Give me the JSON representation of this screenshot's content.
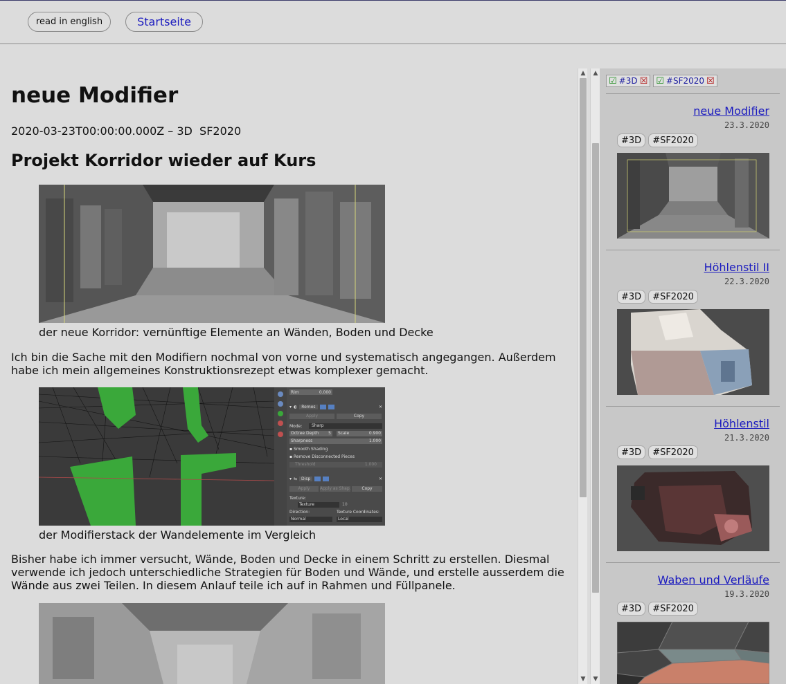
{
  "header": {
    "lang_button": "read in english",
    "home_link": "Startseite"
  },
  "article": {
    "title": "neue Modifier",
    "meta": "2020-03-23T00:00:00.000Z – 3D  SF2020",
    "subtitle": "Projekt Korridor wieder auf Kurs",
    "caption1": "der neue Korridor: vernünftige Elemente an Wänden, Boden und Decke",
    "paragraph1": "Ich bin die Sache mit den Modifiern nochmal von vorne und systematisch angegangen. Außerdem habe ich mein allgemeines Konstruktionsrezept etwas komplexer gemacht.",
    "caption2": "der Modifierstack der Wandelemente im Vergleich",
    "paragraph2": "Bisher habe ich immer versucht, Wände, Boden und Decke in einem Schritt zu erstellen. Diesmal verwende ich jedoch unterschiedliche Strategien für Boden und Wände, und erstelle ausserdem die Wände aus zwei Teilen. In diesem Anlauf teile ich auf in Rahmen und Füllpanele.",
    "blender_panel": {
      "field_rim": "Rim",
      "field_rim_value": "0.000",
      "mod1_name": "Remes",
      "apply": "Apply",
      "copy": "Copy",
      "mode_label": "Mode:",
      "mode_value": "Sharp",
      "octree_label": "Octree Depth",
      "octree_value": "5",
      "scale_label": "Scale",
      "scale_value": "0.900",
      "sharpness_label": "Sharpness",
      "sharpness_value": "1.000",
      "smooth_shading": "Smooth Shading",
      "remove_disconnected": "Remove Disconnected Pieces",
      "threshold_label": "Threshold",
      "threshold_value": "1.000",
      "mod2_name": "Disp",
      "apply_as_shape": "Apply as Shap...",
      "texture_label": "Texture:",
      "texture_value": "Texture",
      "texture_num": "10",
      "direction_label": "Direction:",
      "direction_value": "Normal",
      "coords_label": "Texture Coordinates:",
      "coords_value": "Local"
    }
  },
  "sidebar": {
    "filters": [
      "#3D",
      "#SF2020"
    ],
    "posts": [
      {
        "title": "neue Modifier",
        "date": "23.3.2020",
        "tags": [
          "#3D",
          "#SF2020"
        ]
      },
      {
        "title": "Höhlenstil II",
        "date": "22.3.2020",
        "tags": [
          "#3D",
          "#SF2020"
        ]
      },
      {
        "title": "Höhlenstil",
        "date": "21.3.2020",
        "tags": [
          "#3D",
          "#SF2020"
        ]
      },
      {
        "title": "Waben und Verläufe",
        "date": "19.3.2020",
        "tags": [
          "#3D",
          "#SF2020"
        ]
      }
    ]
  }
}
